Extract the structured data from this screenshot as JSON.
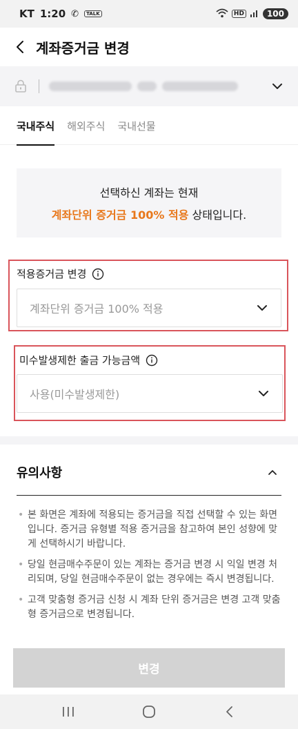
{
  "status_bar": {
    "carrier": "KT",
    "time": "1:20",
    "icon_label": "TALK",
    "network": "HD",
    "battery": "100"
  },
  "header": {
    "title": "계좌증거금 변경"
  },
  "tabs": [
    {
      "label": "국내주식",
      "active": true
    },
    {
      "label": "해외주식",
      "active": false
    },
    {
      "label": "국내선물",
      "active": false
    }
  ],
  "notice": {
    "line1": "선택하신 계좌는 현재",
    "highlight": "계좌단위 증거금 100% 적용",
    "line2_suffix": " 상태입니다."
  },
  "margin_field": {
    "label": "적용증거금 변경",
    "value": "계좌단위 증거금 100% 적용"
  },
  "withdraw_field": {
    "label": "미수발생제한 출금 가능금액",
    "value": "사용(미수발생제한)"
  },
  "caution": {
    "title": "유의사항",
    "items": [
      "본 화면은 계좌에 적용되는 증거금을 직접 선택할 수 있는 화면 입니다. 증거금 유형별 적용 증거금을 참고하여 본인 성향에 맞게 선택하시기 바랍니다.",
      "당일 현금매수주문이 있는 계좌는 증거금 변경 시 익일 변경 처리되며, 당일 현금매수주문이 없는 경우에는 즉시 변경됩니다.",
      "고객 맞춤형 증거금 신청 시 계좌 단위 증거금은 변경 고객 맞춤형 증거금으로 변경됩니다."
    ]
  },
  "submit": {
    "label": "변경"
  },
  "colors": {
    "accent": "#e8781c",
    "highlight_border": "#d9545a",
    "disabled_button": "#d3d3d3"
  }
}
